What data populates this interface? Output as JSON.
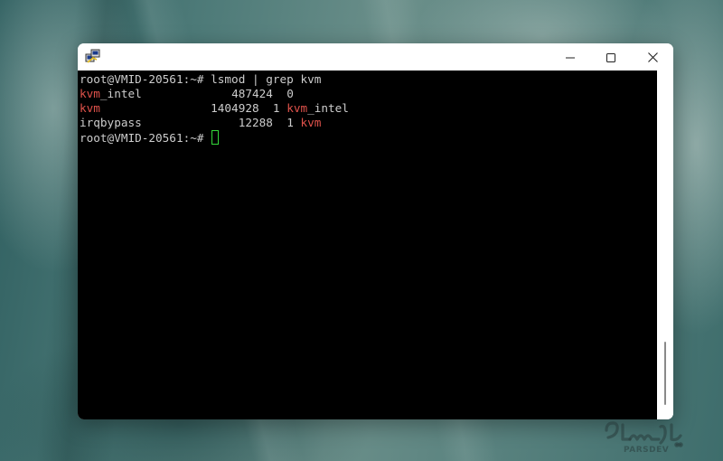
{
  "window": {
    "minimize_icon": "minimize-icon",
    "maximize_icon": "maximize-icon",
    "close_icon": "close-icon",
    "app_icon": "putty-icon"
  },
  "terminal": {
    "prompt": "root@VMID-20561:~#",
    "command": "lsmod | grep kvm",
    "rows": [
      {
        "name_highlight": "kvm",
        "name_rest": "_intel",
        "size": "487424",
        "used": "0",
        "by_highlight": "",
        "by_rest": ""
      },
      {
        "name_highlight": "kvm",
        "name_rest": "",
        "size": "1404928",
        "used": "1",
        "by_highlight": "kvm",
        "by_rest": "_intel"
      },
      {
        "name_highlight": "",
        "name_rest": "irqbypass",
        "size": "12288",
        "used": "1",
        "by_highlight": "kvm",
        "by_rest": ""
      }
    ],
    "colors": {
      "background": "#000000",
      "text": "#cccccc",
      "highlight": "#e0524b",
      "cursor": "#34d83a"
    }
  },
  "watermark": {
    "brand_text": "PARSDEV",
    "logo_lettering": "پارسدو"
  }
}
